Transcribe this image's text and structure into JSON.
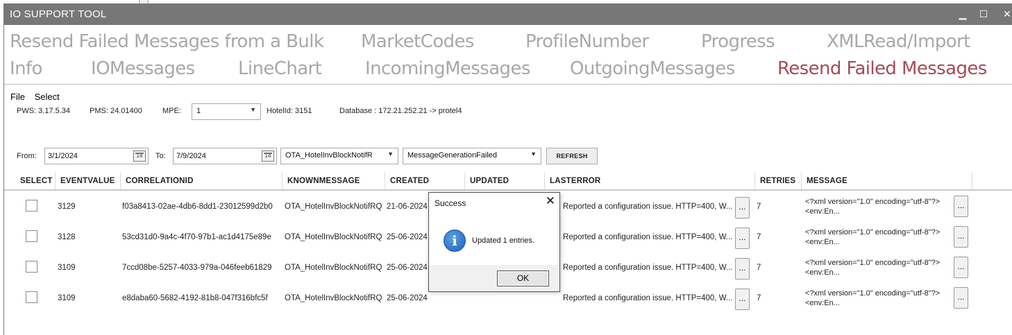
{
  "window": {
    "title": "IO SUPPORT TOOL",
    "minimize_glyph": "▁",
    "maximize_glyph": "☐",
    "close_glyph": "✕"
  },
  "tabs": {
    "row1": [
      "Resend Failed Messages from a Bulk",
      "MarketCodes",
      "ProfileNumber",
      "Progress",
      "XMLRead/Import"
    ],
    "row2": [
      "Info",
      "IOMessages",
      "LineChart",
      "IncomingMessages",
      "OutgoingMessages",
      "Resend Failed Messages"
    ],
    "active": "Resend Failed Messages"
  },
  "menu": {
    "file": "File",
    "select": "Select"
  },
  "info": {
    "pws": "PWS: 3.17.5.34",
    "pms": "PMS: 24.01400",
    "mpe_label": "MPE:",
    "mpe_value": "1",
    "hotel": "HotelId: 3151",
    "database": "Database : 172.21.252.21 -> protel4"
  },
  "filters": {
    "from_label": "From:",
    "from_value": "3/1/2024",
    "to_label": "To:",
    "to_value": "7/9/2024",
    "calendar_glyph": "14",
    "message_type": "OTA_HotelInvBlockNotifR",
    "status": "MessageGenerationFailed",
    "refresh_label": "REFRESH"
  },
  "grid": {
    "columns": [
      "SELECT",
      "EVENTVALUE",
      "CORRELATIONID",
      "KNOWNMESSAGE",
      "CREATED",
      "UPDATED",
      "LASTERROR",
      "RETRIES",
      "MESSAGE"
    ],
    "rows": [
      {
        "eventvalue": "3129",
        "correlationid": "f03a8413-02ae-4db6-8dd1-23012599d2b0",
        "knownmessage": "OTA_HotelInvBlockNotifRQ",
        "created": "21-06-2024",
        "lasterror": "Reported a configuration issue. HTTP=400, W...",
        "retries": "7",
        "message_line1": "<?xml version=\"1.0\" encoding=\"utf-8\"?>",
        "message_line2": "<env:En..."
      },
      {
        "eventvalue": "3128",
        "correlationid": "53cd31d0-9a4c-4f70-97b1-ac1d4175e89e",
        "knownmessage": "OTA_HotelInvBlockNotifRQ",
        "created": "25-06-2024",
        "lasterror": "Reported a configuration issue. HTTP=400, W...",
        "retries": "7",
        "message_line1": "<?xml version=\"1.0\" encoding=\"utf-8\"?>",
        "message_line2": "<env:En..."
      },
      {
        "eventvalue": "3109",
        "correlationid": "7ccd08be-5257-4033-979a-046feeb61829",
        "knownmessage": "OTA_HotelInvBlockNotifRQ",
        "created": "25-06-2024",
        "lasterror": "Reported a configuration issue. HTTP=400, W...",
        "retries": "7",
        "message_line1": "<?xml version=\"1.0\" encoding=\"utf-8\"?>",
        "message_line2": "<env:En..."
      },
      {
        "eventvalue": "3109",
        "correlationid": "e8daba60-5682-4192-81b8-047f316bfc5f",
        "knownmessage": "OTA_HotelInvBlockNotifRQ",
        "created": "25-06-2024",
        "lasterror": "Reported a configuration issue. HTTP=400, W...",
        "retries": "7",
        "message_line1": "<?xml version=\"1.0\" encoding=\"utf-8\"?>",
        "message_line2": "<env:En..."
      }
    ],
    "ellipsis": "..."
  },
  "dialog": {
    "title": "Success",
    "message": "Updated 1 entries.",
    "ok_label": "OK",
    "close_glyph": "✕",
    "icon_glyph": "i"
  }
}
